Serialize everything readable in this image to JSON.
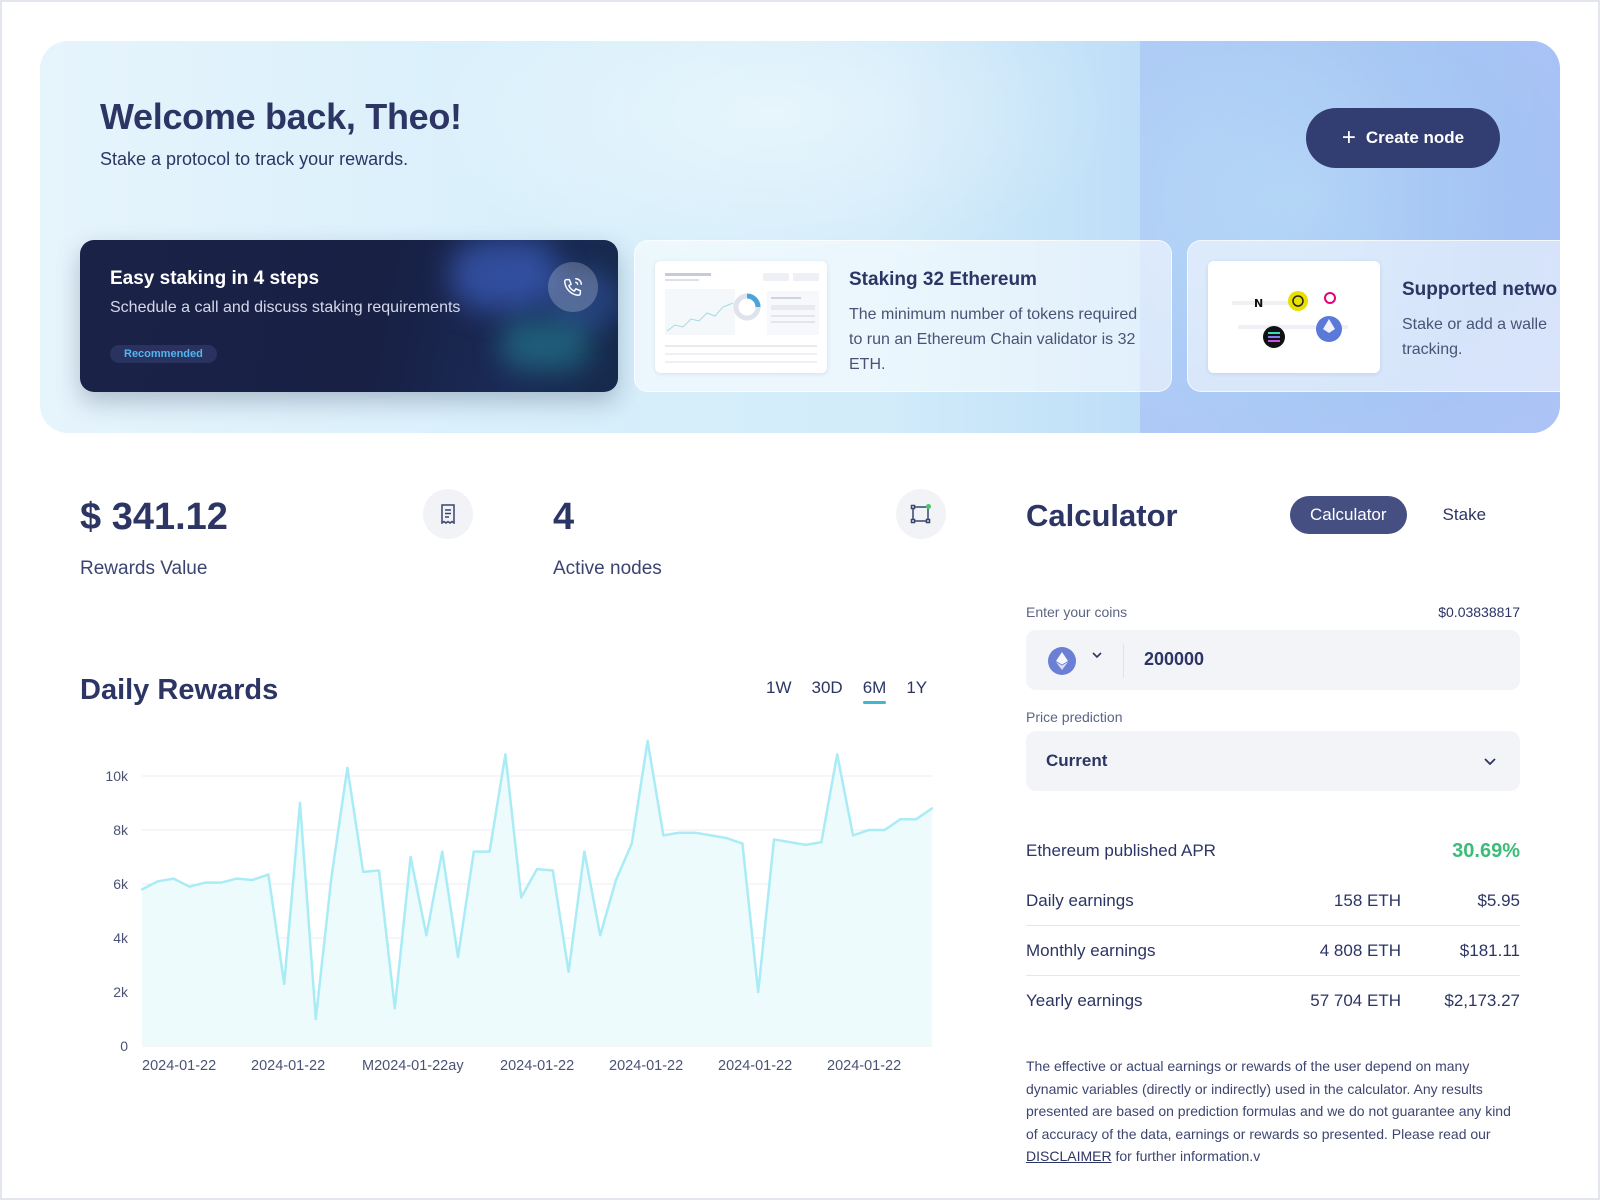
{
  "hero": {
    "title": "Welcome back, Theo!",
    "subtitle": "Stake a protocol to track your rewards.",
    "create_node_label": "Create node",
    "cards": [
      {
        "title": "Easy staking in 4 steps",
        "description": "Schedule a call and discuss staking requirements",
        "badge": "Recommended",
        "icon": "phone-icon"
      },
      {
        "title": "Staking 32 Ethereum",
        "description": "The minimum number of tokens required to run an Ethereum Chain validator is 32 ETH."
      },
      {
        "title": "Supported netwo",
        "description": "Stake or add a walle tracking."
      }
    ]
  },
  "stats": {
    "rewards_value": "$ 341.12",
    "rewards_label": "Rewards Value",
    "active_nodes_value": "4",
    "active_nodes_label": "Active nodes"
  },
  "daily_rewards": {
    "title": "Daily Rewards",
    "ranges": [
      "1W",
      "30D",
      "6M",
      "1Y"
    ],
    "active_range": "6M"
  },
  "chart_data": {
    "type": "area",
    "title": "Daily Rewards",
    "xlabel": "",
    "ylabel": "",
    "ylim": [
      0,
      10000
    ],
    "y_ticks": [
      "0",
      "2k",
      "4k",
      "6k",
      "8k",
      "10k"
    ],
    "x_tick_labels": [
      "2024-01-22",
      "2024-01-22",
      "M2024-01-22ay",
      "2024-01-22",
      "2024-01-22",
      "2024-01-22",
      "2024-01-22"
    ],
    "grid": true,
    "color": "#a9ecf6",
    "values": [
      5800,
      6100,
      6200,
      5900,
      6050,
      6050,
      6200,
      6150,
      6350,
      2300,
      9000,
      1000,
      6300,
      10300,
      6450,
      6500,
      1400,
      7000,
      4100,
      7200,
      3300,
      7200,
      7200,
      10800,
      5500,
      6550,
      6500,
      2750,
      7200,
      4100,
      6150,
      7500,
      11300,
      7800,
      7900,
      7900,
      7800,
      7700,
      7500,
      2000,
      7650,
      7550,
      7450,
      7550,
      10800,
      7800,
      8000,
      8000,
      8400,
      8400,
      8800
    ]
  },
  "calculator": {
    "title": "Calculator",
    "tabs": [
      "Calculator",
      "Stake"
    ],
    "active_tab": "Calculator",
    "coins_label": "Enter your coins",
    "coin_price": "$0.03838817",
    "coins_value": "200000",
    "coin_icon": "ethereum-icon",
    "prediction_label": "Price prediction",
    "prediction_value": "Current",
    "apr_label": "Ethereum published APR",
    "apr_value": "30.69%",
    "apr_color": "#3dbb78",
    "earnings": [
      {
        "label": "Daily earnings",
        "eth": "158 ETH",
        "usd": "$5.95"
      },
      {
        "label": "Monthly earnings",
        "eth": "4 808 ETH",
        "usd": "$181.11"
      },
      {
        "label": "Yearly earnings",
        "eth": "57 704 ETH",
        "usd": "$2,173.27"
      }
    ],
    "disclaimer_text": "The effective or actual earnings or rewards of the user depend on many dynamic variables (directly or indirectly) used in the calculator. Any results presented are based on prediction formulas and we do not guarantee any kind of accuracy of the data, earnings or rewards so presented. Please read our",
    "disclaimer_link": "DISCLAIMER",
    "disclaimer_tail": "for further information.v"
  },
  "colors": {
    "brand_dark": "#323e72",
    "accent_teal": "#3fb7cf",
    "positive": "#3dbb78"
  }
}
